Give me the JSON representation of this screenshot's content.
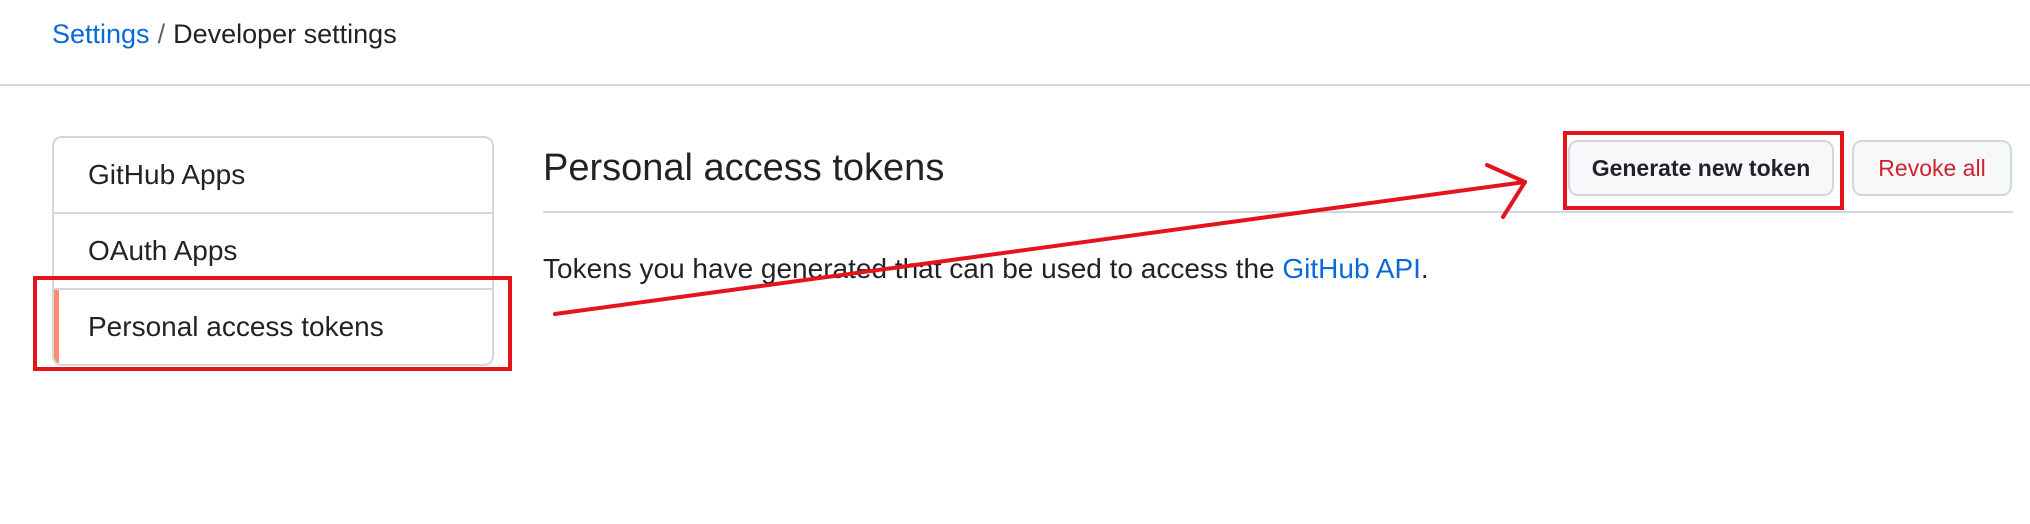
{
  "breadcrumb": {
    "parent": "Settings",
    "separator": "/",
    "current": "Developer settings"
  },
  "sidebar": {
    "items": [
      {
        "label": "GitHub Apps"
      },
      {
        "label": "OAuth Apps"
      },
      {
        "label": "Personal access tokens",
        "selected": true
      }
    ]
  },
  "main": {
    "title": "Personal access tokens",
    "generate_button": "Generate new token",
    "revoke_button": "Revoke all",
    "description_prefix": "Tokens you have generated that can be used to access the ",
    "description_link": "GitHub API",
    "description_suffix": "."
  },
  "colors": {
    "link": "#0969da",
    "danger": "#cf222e",
    "selected_indicator": "#fd8c73",
    "annotation": "#e3141b",
    "border": "#d0d7de"
  }
}
